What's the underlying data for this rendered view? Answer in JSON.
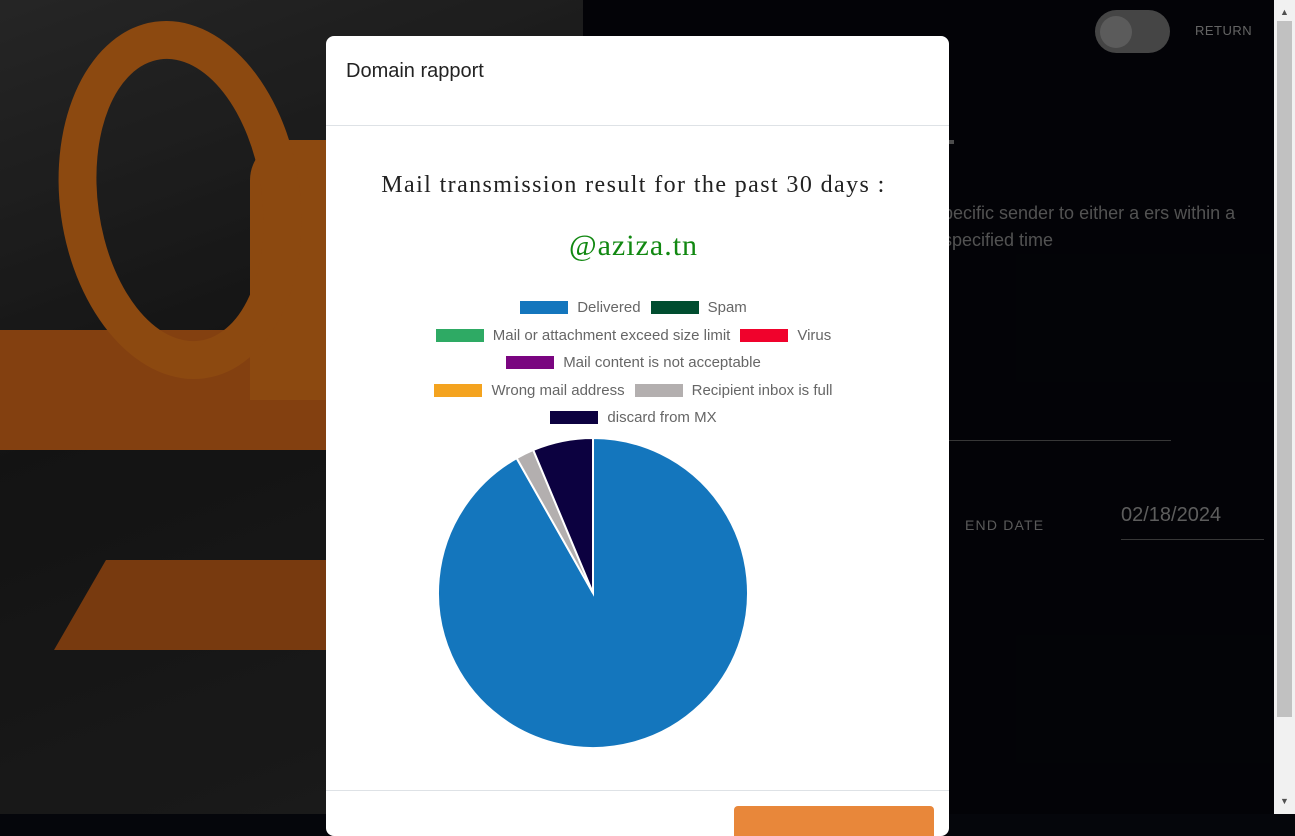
{
  "page": {
    "toggle_state": "off",
    "return_label": "RETURN",
    "description_visible": "pecific sender to either a ers within a specified time",
    "end_date_label": "END DATE",
    "end_date_value": "02/18/2024"
  },
  "modal": {
    "title": "Domain rapport",
    "footer_button_color": "#e8873a"
  },
  "chart_data": {
    "type": "pie",
    "title": "Mail transmission result for the past 30 days :",
    "subtitle": "@aziza.tn",
    "subtitle_color": "#118811",
    "legend_position": "top",
    "categories": [
      "Delivered",
      "Spam",
      "Mail or attachment exceed size limit",
      "Virus",
      "Mail content is not acceptable",
      "Wrong mail address",
      "Recipient inbox is full",
      "discard from MX"
    ],
    "colors": [
      "#1476bd",
      "#004d2f",
      "#2eaa64",
      "#f0022c",
      "#7a0580",
      "#f4a31f",
      "#b3afaf",
      "#0c0140"
    ],
    "values": [
      91.8,
      0,
      0,
      0,
      0,
      0,
      1.9,
      6.3
    ]
  }
}
